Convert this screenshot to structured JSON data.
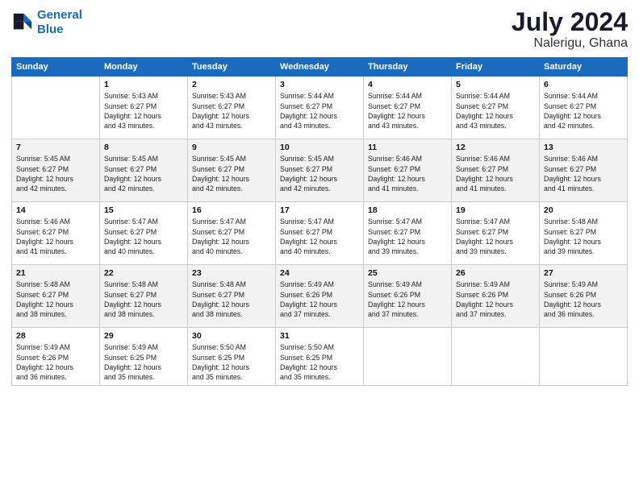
{
  "header": {
    "logo_line1": "General",
    "logo_line2": "Blue",
    "month": "July 2024",
    "location": "Nalerigu, Ghana"
  },
  "weekdays": [
    "Sunday",
    "Monday",
    "Tuesday",
    "Wednesday",
    "Thursday",
    "Friday",
    "Saturday"
  ],
  "weeks": [
    [
      {
        "day": "",
        "sunrise": "",
        "sunset": "",
        "daylight": ""
      },
      {
        "day": "1",
        "sunrise": "Sunrise: 5:43 AM",
        "sunset": "Sunset: 6:27 PM",
        "daylight": "Daylight: 12 hours and 43 minutes."
      },
      {
        "day": "2",
        "sunrise": "Sunrise: 5:43 AM",
        "sunset": "Sunset: 6:27 PM",
        "daylight": "Daylight: 12 hours and 43 minutes."
      },
      {
        "day": "3",
        "sunrise": "Sunrise: 5:44 AM",
        "sunset": "Sunset: 6:27 PM",
        "daylight": "Daylight: 12 hours and 43 minutes."
      },
      {
        "day": "4",
        "sunrise": "Sunrise: 5:44 AM",
        "sunset": "Sunset: 6:27 PM",
        "daylight": "Daylight: 12 hours and 43 minutes."
      },
      {
        "day": "5",
        "sunrise": "Sunrise: 5:44 AM",
        "sunset": "Sunset: 6:27 PM",
        "daylight": "Daylight: 12 hours and 43 minutes."
      },
      {
        "day": "6",
        "sunrise": "Sunrise: 5:44 AM",
        "sunset": "Sunset: 6:27 PM",
        "daylight": "Daylight: 12 hours and 42 minutes."
      }
    ],
    [
      {
        "day": "7",
        "sunrise": "Sunrise: 5:45 AM",
        "sunset": "Sunset: 6:27 PM",
        "daylight": "Daylight: 12 hours and 42 minutes."
      },
      {
        "day": "8",
        "sunrise": "Sunrise: 5:45 AM",
        "sunset": "Sunset: 6:27 PM",
        "daylight": "Daylight: 12 hours and 42 minutes."
      },
      {
        "day": "9",
        "sunrise": "Sunrise: 5:45 AM",
        "sunset": "Sunset: 6:27 PM",
        "daylight": "Daylight: 12 hours and 42 minutes."
      },
      {
        "day": "10",
        "sunrise": "Sunrise: 5:45 AM",
        "sunset": "Sunset: 6:27 PM",
        "daylight": "Daylight: 12 hours and 42 minutes."
      },
      {
        "day": "11",
        "sunrise": "Sunrise: 5:46 AM",
        "sunset": "Sunset: 6:27 PM",
        "daylight": "Daylight: 12 hours and 41 minutes."
      },
      {
        "day": "12",
        "sunrise": "Sunrise: 5:46 AM",
        "sunset": "Sunset: 6:27 PM",
        "daylight": "Daylight: 12 hours and 41 minutes."
      },
      {
        "day": "13",
        "sunrise": "Sunrise: 5:46 AM",
        "sunset": "Sunset: 6:27 PM",
        "daylight": "Daylight: 12 hours and 41 minutes."
      }
    ],
    [
      {
        "day": "14",
        "sunrise": "Sunrise: 5:46 AM",
        "sunset": "Sunset: 6:27 PM",
        "daylight": "Daylight: 12 hours and 41 minutes."
      },
      {
        "day": "15",
        "sunrise": "Sunrise: 5:47 AM",
        "sunset": "Sunset: 6:27 PM",
        "daylight": "Daylight: 12 hours and 40 minutes."
      },
      {
        "day": "16",
        "sunrise": "Sunrise: 5:47 AM",
        "sunset": "Sunset: 6:27 PM",
        "daylight": "Daylight: 12 hours and 40 minutes."
      },
      {
        "day": "17",
        "sunrise": "Sunrise: 5:47 AM",
        "sunset": "Sunset: 6:27 PM",
        "daylight": "Daylight: 12 hours and 40 minutes."
      },
      {
        "day": "18",
        "sunrise": "Sunrise: 5:47 AM",
        "sunset": "Sunset: 6:27 PM",
        "daylight": "Daylight: 12 hours and 39 minutes."
      },
      {
        "day": "19",
        "sunrise": "Sunrise: 5:47 AM",
        "sunset": "Sunset: 6:27 PM",
        "daylight": "Daylight: 12 hours and 39 minutes."
      },
      {
        "day": "20",
        "sunrise": "Sunrise: 5:48 AM",
        "sunset": "Sunset: 6:27 PM",
        "daylight": "Daylight: 12 hours and 39 minutes."
      }
    ],
    [
      {
        "day": "21",
        "sunrise": "Sunrise: 5:48 AM",
        "sunset": "Sunset: 6:27 PM",
        "daylight": "Daylight: 12 hours and 38 minutes."
      },
      {
        "day": "22",
        "sunrise": "Sunrise: 5:48 AM",
        "sunset": "Sunset: 6:27 PM",
        "daylight": "Daylight: 12 hours and 38 minutes."
      },
      {
        "day": "23",
        "sunrise": "Sunrise: 5:48 AM",
        "sunset": "Sunset: 6:27 PM",
        "daylight": "Daylight: 12 hours and 38 minutes."
      },
      {
        "day": "24",
        "sunrise": "Sunrise: 5:49 AM",
        "sunset": "Sunset: 6:26 PM",
        "daylight": "Daylight: 12 hours and 37 minutes."
      },
      {
        "day": "25",
        "sunrise": "Sunrise: 5:49 AM",
        "sunset": "Sunset: 6:26 PM",
        "daylight": "Daylight: 12 hours and 37 minutes."
      },
      {
        "day": "26",
        "sunrise": "Sunrise: 5:49 AM",
        "sunset": "Sunset: 6:26 PM",
        "daylight": "Daylight: 12 hours and 37 minutes."
      },
      {
        "day": "27",
        "sunrise": "Sunrise: 5:49 AM",
        "sunset": "Sunset: 6:26 PM",
        "daylight": "Daylight: 12 hours and 36 minutes."
      }
    ],
    [
      {
        "day": "28",
        "sunrise": "Sunrise: 5:49 AM",
        "sunset": "Sunset: 6:26 PM",
        "daylight": "Daylight: 12 hours and 36 minutes."
      },
      {
        "day": "29",
        "sunrise": "Sunrise: 5:49 AM",
        "sunset": "Sunset: 6:25 PM",
        "daylight": "Daylight: 12 hours and 35 minutes."
      },
      {
        "day": "30",
        "sunrise": "Sunrise: 5:50 AM",
        "sunset": "Sunset: 6:25 PM",
        "daylight": "Daylight: 12 hours and 35 minutes."
      },
      {
        "day": "31",
        "sunrise": "Sunrise: 5:50 AM",
        "sunset": "Sunset: 6:25 PM",
        "daylight": "Daylight: 12 hours and 35 minutes."
      },
      {
        "day": "",
        "sunrise": "",
        "sunset": "",
        "daylight": ""
      },
      {
        "day": "",
        "sunrise": "",
        "sunset": "",
        "daylight": ""
      },
      {
        "day": "",
        "sunrise": "",
        "sunset": "",
        "daylight": ""
      }
    ]
  ]
}
